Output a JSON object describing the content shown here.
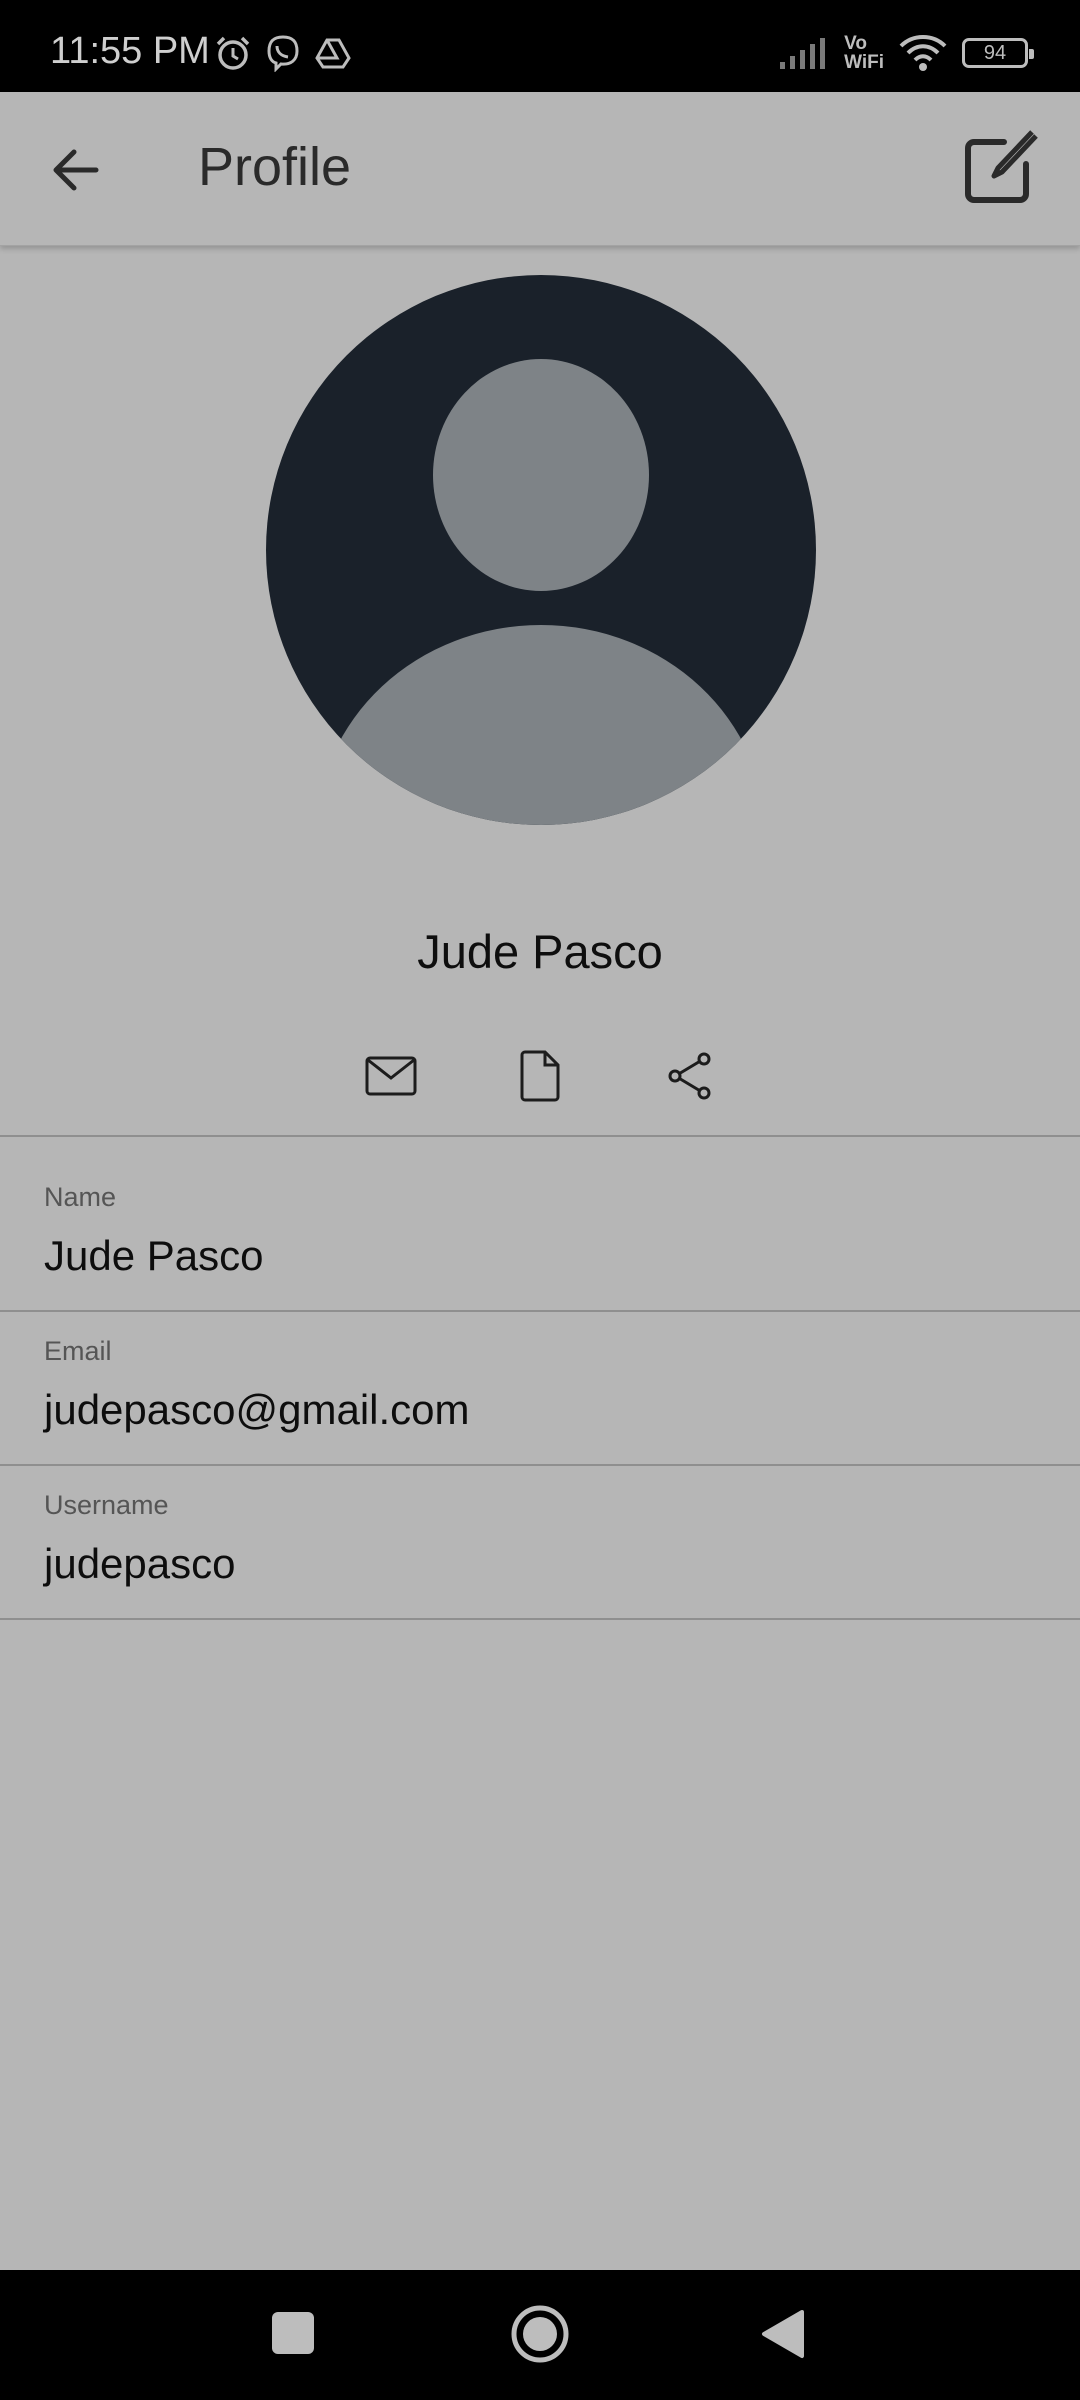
{
  "status": {
    "time": "11:55 PM",
    "network_label_top": "Vo",
    "network_label_bottom": "WiFi",
    "battery": "94"
  },
  "appbar": {
    "title": "Profile"
  },
  "profile": {
    "display_name": "Jude Pasco"
  },
  "fields": [
    {
      "label": "Name",
      "value": "Jude Pasco"
    },
    {
      "label": "Email",
      "value": "judepasco@gmail.com"
    },
    {
      "label": "Username",
      "value": "judepasco"
    }
  ],
  "icons": {
    "back": "arrow-left-icon",
    "edit": "edit-icon",
    "email": "mail-icon",
    "document": "document-icon",
    "share": "share-icon"
  },
  "colors": {
    "background": "#b6b6b6",
    "avatar_bg": "#1a212a",
    "avatar_fg": "#7e8387",
    "system_bars": "#000000"
  }
}
